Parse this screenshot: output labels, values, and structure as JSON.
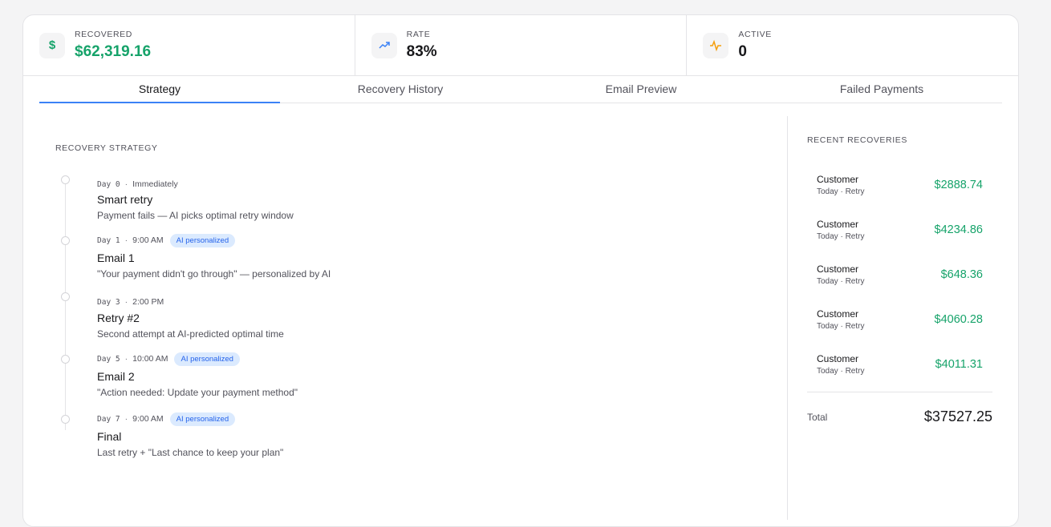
{
  "colors": {
    "accent": "#3b82f6",
    "green": "#16a36a",
    "orange": "#f59e0b",
    "badge_bg": "#dbeafe"
  },
  "stats": [
    {
      "label": "RECOVERED",
      "value": "$62,319.16",
      "icon": "dollar-icon"
    },
    {
      "label": "RATE",
      "value": "83%",
      "icon": "trend-up-icon"
    },
    {
      "label": "ACTIVE",
      "value": "0",
      "icon": "activity-icon"
    }
  ],
  "tabs": [
    {
      "label": "Strategy",
      "active": true
    },
    {
      "label": "Recovery History"
    },
    {
      "label": "Email Preview"
    },
    {
      "label": "Failed Payments"
    }
  ],
  "strategy": {
    "title": "RECOVERY STRATEGY",
    "steps": [
      {
        "day": "Day 0",
        "time": "Immediately",
        "badge": "",
        "title": "Smart retry",
        "desc": "Payment fails — AI picks optimal retry window"
      },
      {
        "day": "Day 1",
        "time": "9:00 AM",
        "badge": "AI personalized",
        "title": "Email 1",
        "desc": "\"Your payment didn't go through\" — personalized by AI"
      },
      {
        "day": "Day 3",
        "time": "2:00 PM",
        "badge": "",
        "title": "Retry #2",
        "desc": "Second attempt at AI-predicted optimal time"
      },
      {
        "day": "Day 5",
        "time": "10:00 AM",
        "badge": "AI personalized",
        "title": "Email 2",
        "desc": "\"Action needed: Update your payment method\""
      },
      {
        "day": "Day 7",
        "time": "9:00 AM",
        "badge": "AI personalized",
        "title": "Final",
        "desc": "Last retry + \"Last chance to keep your plan\""
      }
    ]
  },
  "recent": {
    "title": "RECENT RECOVERIES",
    "items": [
      {
        "name": "Customer",
        "sub": "Today · Retry",
        "amount": "$2888.74"
      },
      {
        "name": "Customer",
        "sub": "Today · Retry",
        "amount": "$4234.86"
      },
      {
        "name": "Customer",
        "sub": "Today · Retry",
        "amount": "$648.36"
      },
      {
        "name": "Customer",
        "sub": "Today · Retry",
        "amount": "$4060.28"
      },
      {
        "name": "Customer",
        "sub": "Today · Retry",
        "amount": "$4011.31"
      }
    ],
    "total_label": "Total",
    "total_value": "$37527.25"
  }
}
